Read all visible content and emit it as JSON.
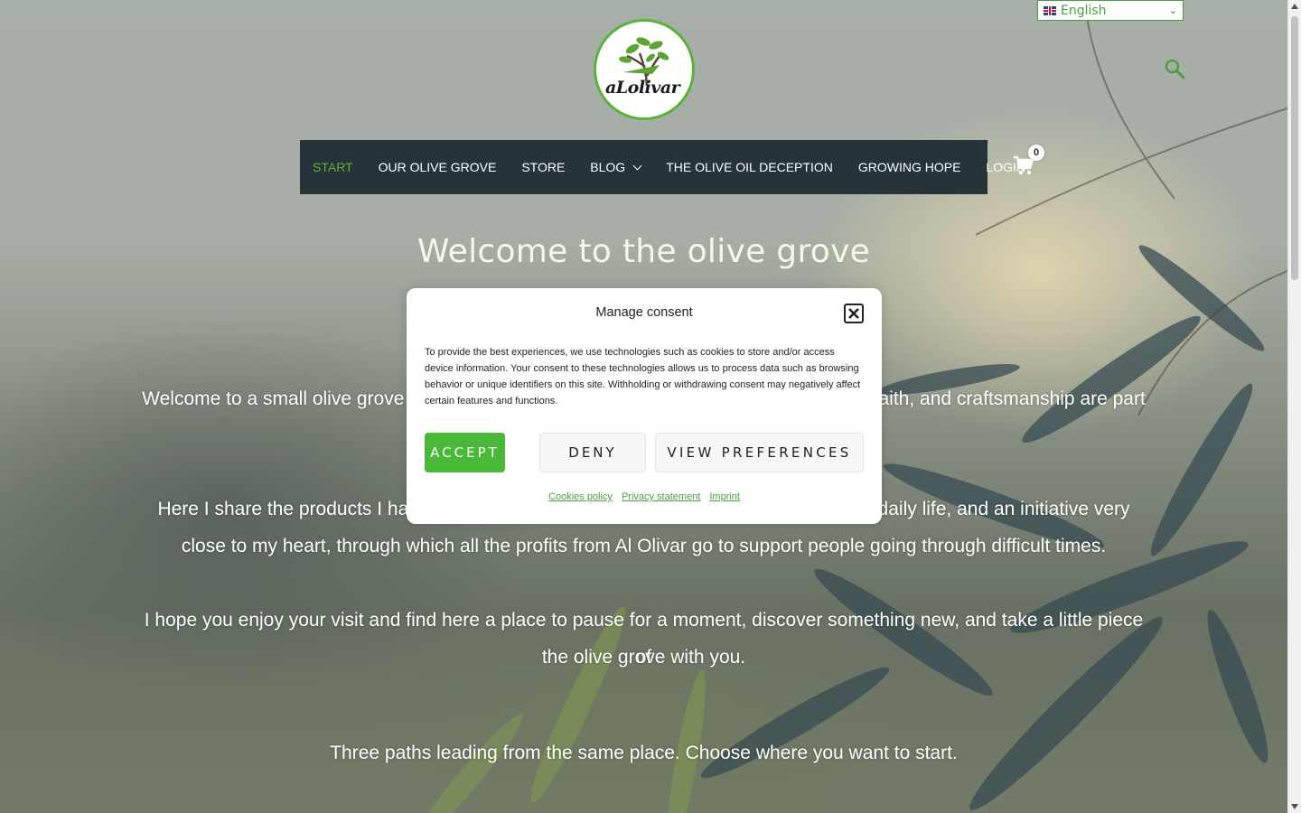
{
  "language_selector": {
    "value": "English",
    "flag_icon": "uk-flag-icon"
  },
  "logo": {
    "text": "aLolivar"
  },
  "search": {
    "icon": "search-icon",
    "color": "#4a9d40"
  },
  "nav": {
    "items": [
      {
        "label": "START",
        "active": true
      },
      {
        "label": "OUR OLIVE GROVE"
      },
      {
        "label": "STORE"
      },
      {
        "label": "BLOG",
        "has_dropdown": true
      },
      {
        "label": "THE OLIVE OIL DECEPTION"
      },
      {
        "label": "GROWING HOPE"
      },
      {
        "label": "LOGIN"
      }
    ],
    "background": "#26343a",
    "active_color": "#5bb13c"
  },
  "cart": {
    "count": "0",
    "icon": "cart-icon"
  },
  "hero": {
    "title": "Welcome to the olive grove",
    "paragraph1": "Welcome to a small olive grove b                                                                                      faith, and craftsmanship are part",
    "paragraph2_line1": "Here I share the products I han                                                                                       daily life, and an initiative very",
    "paragraph2_line2": "close to my heart, through which all the profits from Al Olivar go to support people going through difficult times.",
    "paragraph3_line1": "I hope you enjoy your visit and find here a place to pause for a moment, discover something new, and take a little piece of",
    "paragraph3_line2": "the olive grove with you.",
    "paragraph4": "Three paths leading from the same place. Choose where you want to start."
  },
  "consent": {
    "title": "Manage consent",
    "body": "To provide the best experiences, we use technologies such as cookies to store and/or access device information. Your consent to these technologies allows us to process data such as browsing behavior or unique identifiers on this site. Withholding or withdrawing consent may negatively affect certain features and functions.",
    "accept_label": "ACCEPT",
    "deny_label": "DENY",
    "preferences_label": "VIEW PREFERENCES",
    "links": [
      "Cookies policy",
      "Privacy statement",
      "Imprint"
    ],
    "accent_color": "#4ab838"
  }
}
